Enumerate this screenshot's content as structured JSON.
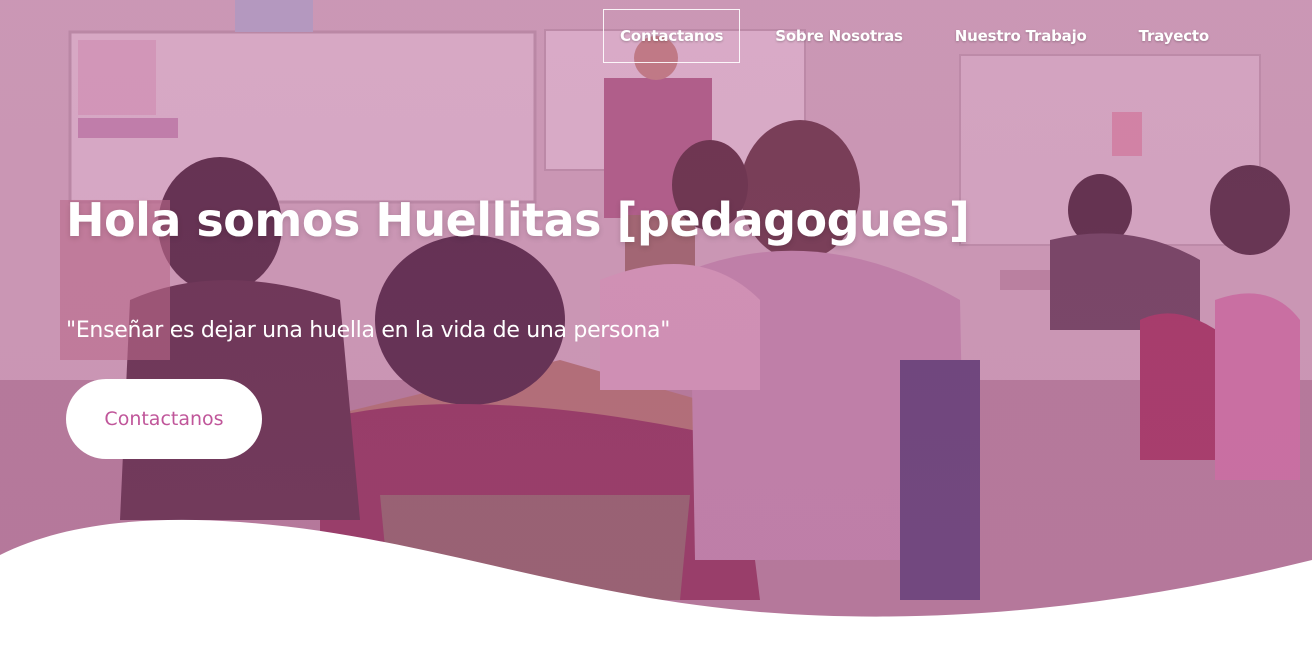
{
  "nav": {
    "items": [
      {
        "label": "Contactanos",
        "active": true
      },
      {
        "label": "Sobre Nosotras",
        "active": false
      },
      {
        "label": "Nuestro Trabajo",
        "active": false
      },
      {
        "label": "Trayecto",
        "active": false
      }
    ]
  },
  "hero": {
    "title": "Hola somos Huellitas [pedagogues]",
    "quote": "\"Enseñar es dejar una huella en la vida de una persona\"",
    "cta_label": "Contactanos"
  },
  "colors": {
    "overlay": "#b0468a",
    "cta_text": "#c0569a",
    "wave": "#ffffff"
  }
}
